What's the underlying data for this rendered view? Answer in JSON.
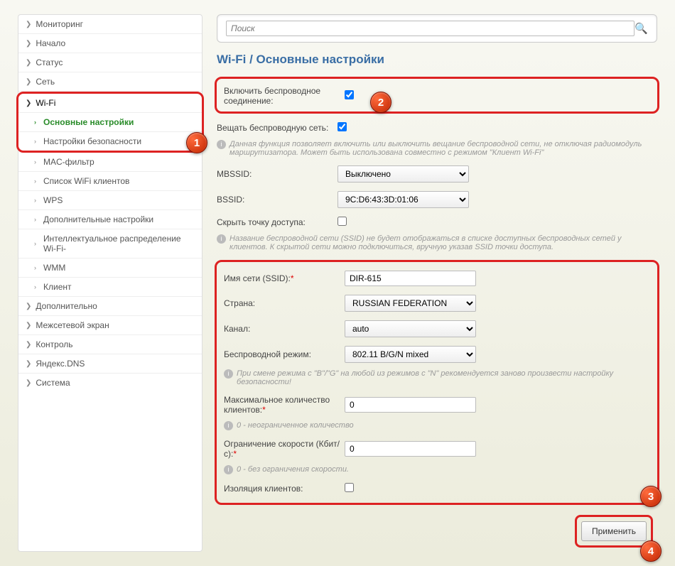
{
  "search": {
    "placeholder": "Поиск"
  },
  "title": "Wi-Fi /  Основные настройки",
  "nav": {
    "top": [
      "Мониторинг",
      "Начало",
      "Статус",
      "Сеть"
    ],
    "wifi": "Wi-Fi",
    "wifi_sub": [
      "Основные настройки",
      "Настройки безопасности",
      "MAC-фильтр",
      "Список WiFi клиентов",
      "WPS",
      "Дополнительные настройки",
      "Интеллектуальное распределение Wi-Fi-",
      "WMM",
      "Клиент"
    ],
    "bottom": [
      "Дополнительно",
      "Межсетевой экран",
      "Контроль",
      "Яндекс.DNS",
      "Система"
    ]
  },
  "form": {
    "enable_wireless": "Включить беспроводное соединение:",
    "broadcast": "Вещать беспроводную сеть:",
    "hint1": "Данная функция позволяет включить или выключить вещание беспроводной сети, не отключая радиомодуль маршрутизатора. Может быть использована совместно с режимом \"Клиент Wi-Fi\"",
    "mbssid_label": "MBSSID:",
    "mbssid_value": "Выключено",
    "bssid_label": "BSSID:",
    "bssid_value": "9C:D6:43:3D:01:06",
    "hide_ap": "Скрыть точку доступа:",
    "hint2": "Название беспроводной сети (SSID) не будет отображаться в списке доступных беспроводных сетей у клиентов. К скрытой сети можно подключиться, вручную указав SSID точки доступа.",
    "ssid_label": "Имя сети (SSID):",
    "ssid_value": "DIR-615",
    "country_label": "Страна:",
    "country_value": "RUSSIAN FEDERATION",
    "channel_label": "Канал:",
    "channel_value": "auto",
    "mode_label": "Беспроводной режим:",
    "mode_value": "802.11 B/G/N mixed",
    "hint3": "При смене режима с \"B\"/\"G\" на любой из режимов с \"N\" рекомендуется заново произвести настройку безопасности!",
    "max_clients_label": "Максимальное количество клиентов:",
    "max_clients_value": "0",
    "hint4": "0 - неограниченное количество",
    "speed_label": "Ограничение скорости (Кбит/с):",
    "speed_value": "0",
    "hint5": "0 - без ограничения скорости.",
    "isolation_label": "Изоляция клиентов:"
  },
  "apply": "Применить",
  "badges": {
    "b1": "1",
    "b2": "2",
    "b3": "3",
    "b4": "4"
  }
}
